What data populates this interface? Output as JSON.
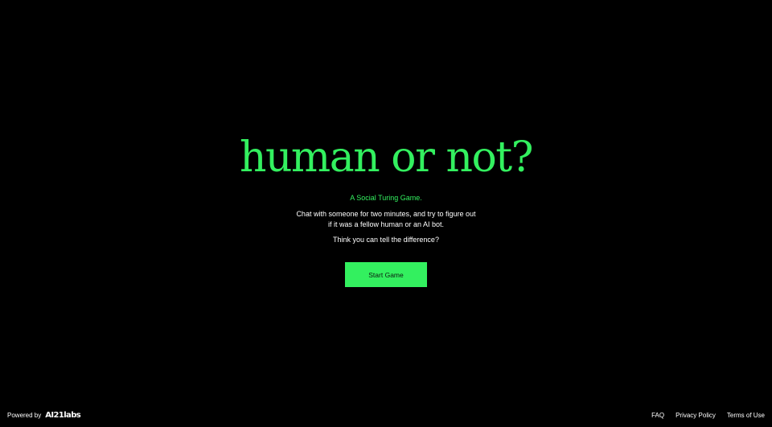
{
  "colors": {
    "background": "#000000",
    "accent": "#33f05f",
    "text": "#ffffff"
  },
  "hero": {
    "title": "human or not?",
    "subtitle": "A Social Turing Game.",
    "description": "Chat with someone for two minutes, and try to figure out if it was a fellow human or an AI bot.",
    "question": "Think you can tell the difference?",
    "start_button_label": "Start Game"
  },
  "footer": {
    "powered_by": "Powered by",
    "logo_text": "AI21labs",
    "links": [
      "FAQ",
      "Privacy Policy",
      "Terms of Use"
    ]
  }
}
